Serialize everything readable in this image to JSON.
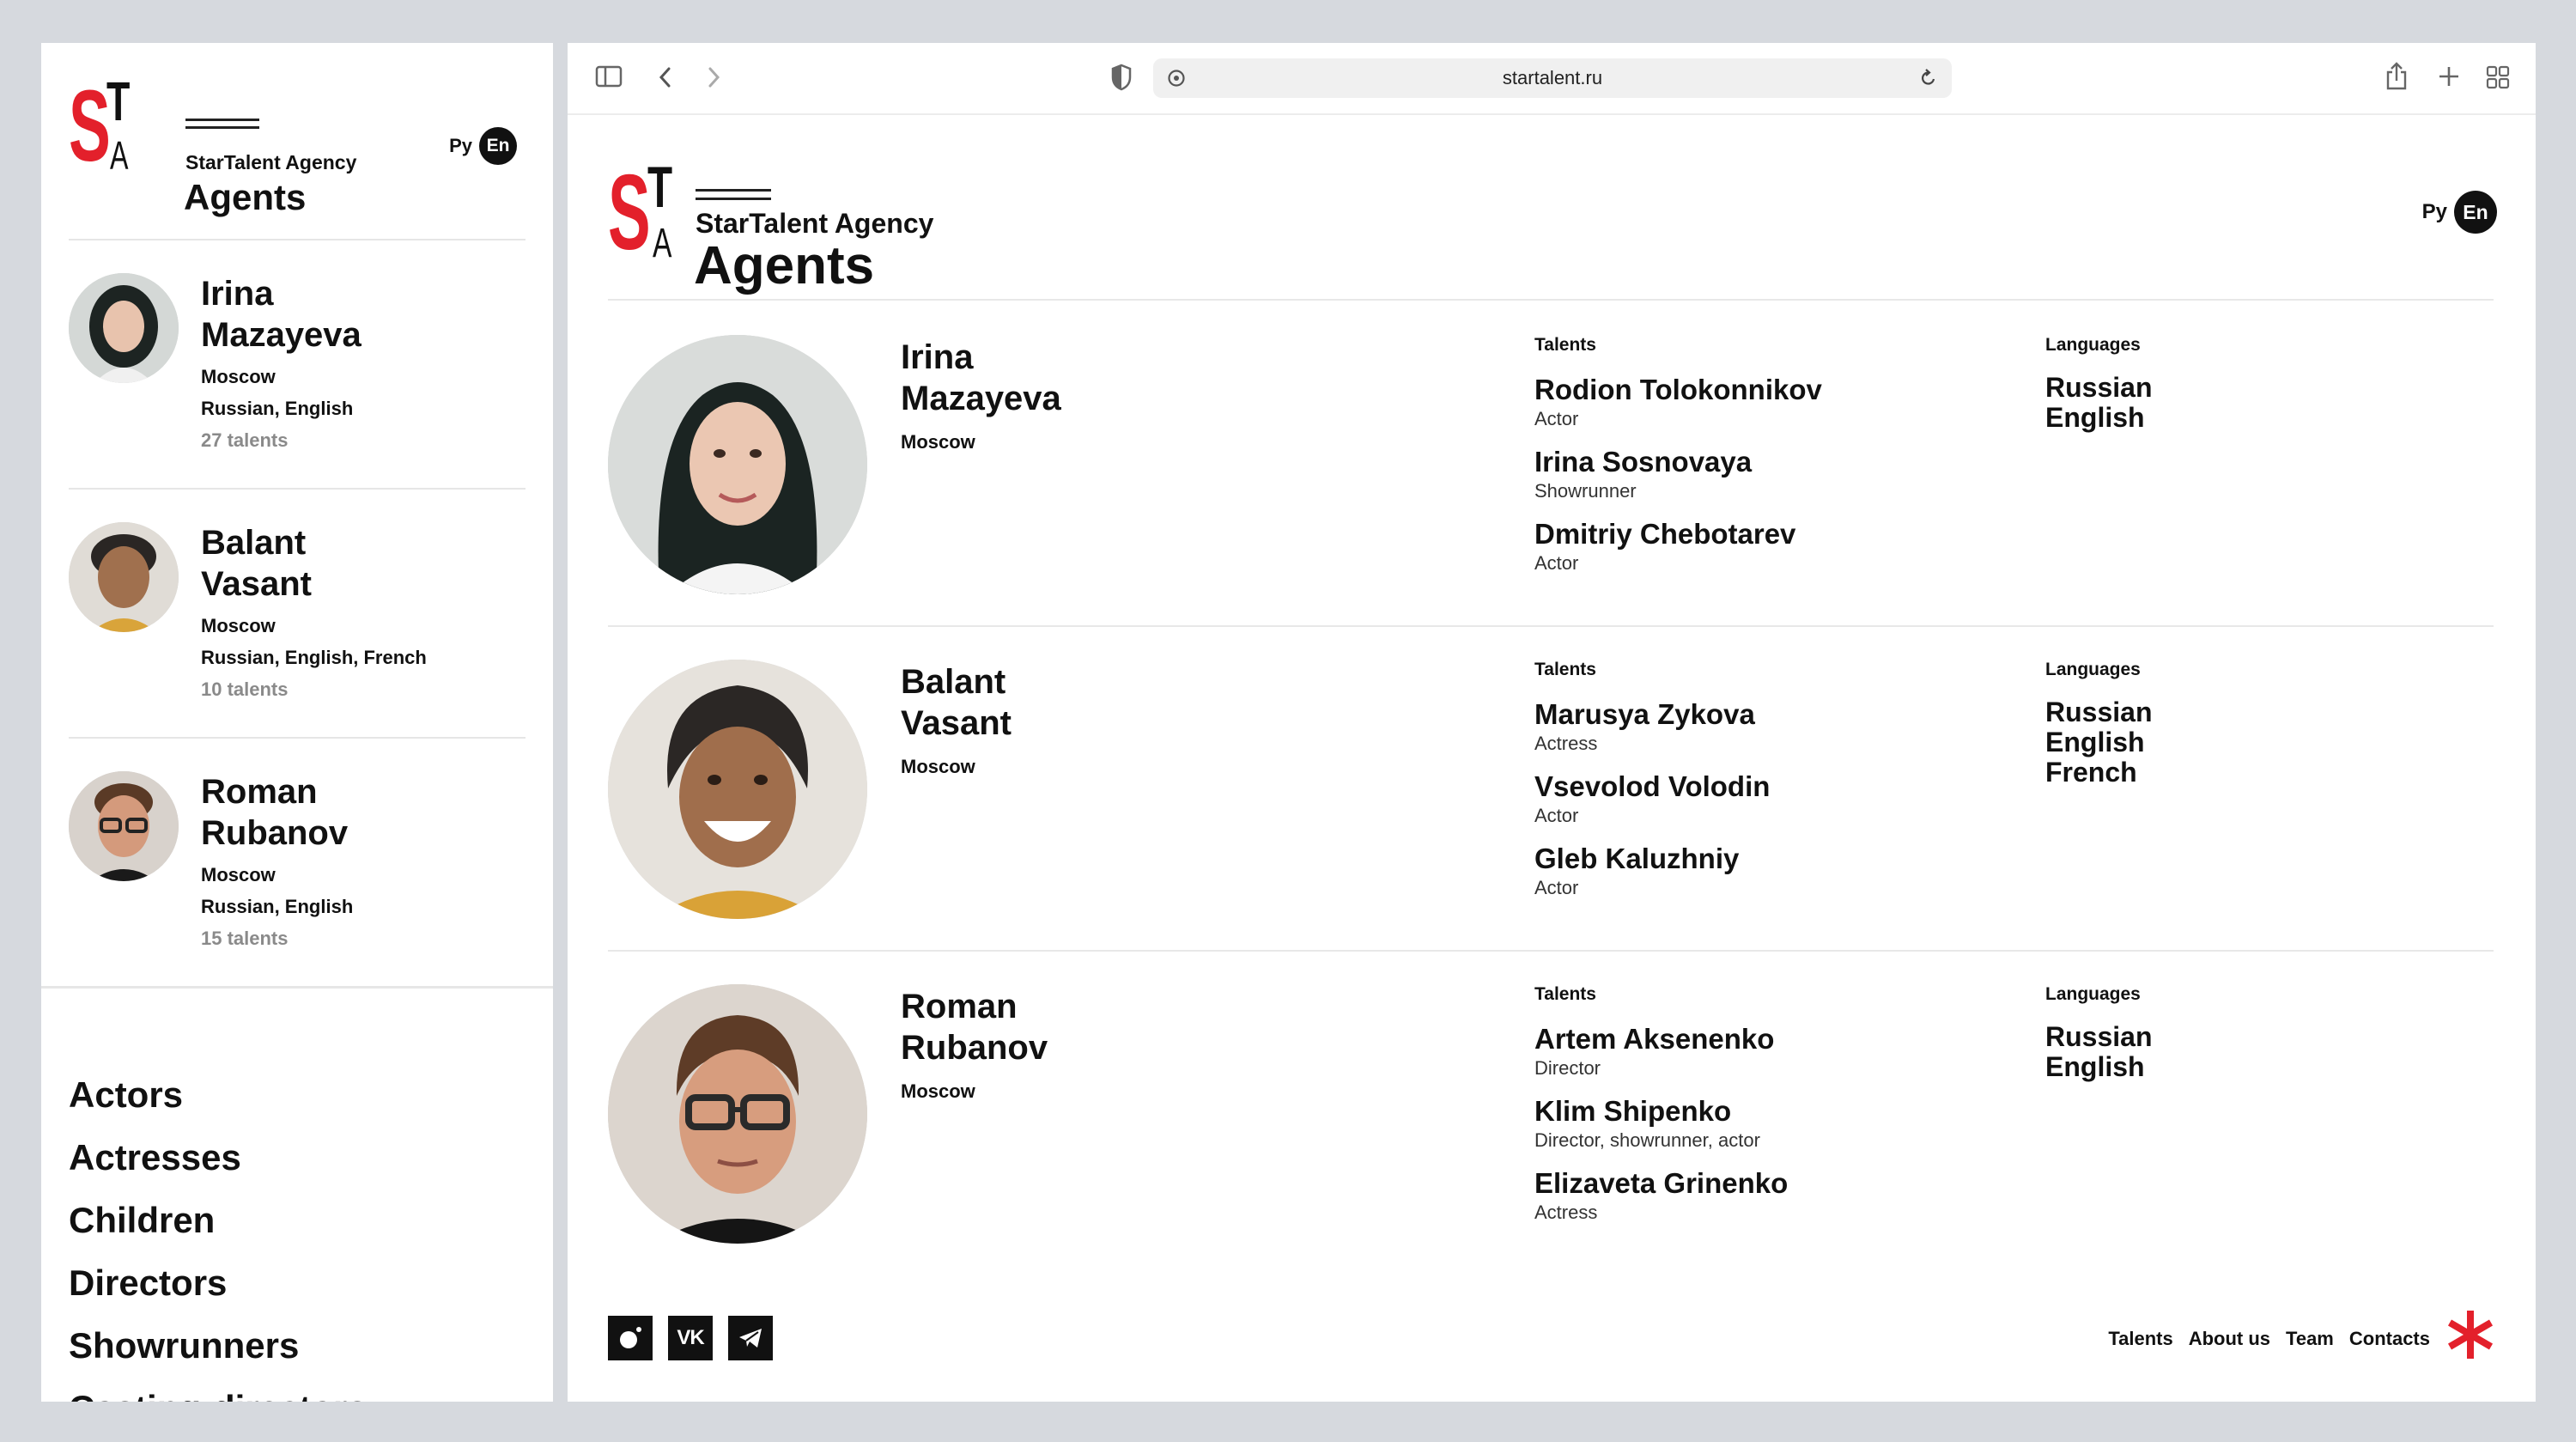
{
  "brand": {
    "logo_letters": [
      "S",
      "T",
      "A"
    ],
    "agency": "StarTalent Agency",
    "page_title": "Agents",
    "accent_color": "#e3202b"
  },
  "lang_switch": {
    "ru": "Ру",
    "en": "En"
  },
  "browser": {
    "url": "startalent.ru",
    "icons": [
      "sidebar-icon",
      "back-icon",
      "forward-icon",
      "shield-icon",
      "site-settings-icon",
      "reload-icon",
      "share-icon",
      "new-tab-icon",
      "tab-overview-icon"
    ]
  },
  "columns": {
    "talents": "Talents",
    "languages": "Languages"
  },
  "agents": [
    {
      "first": "Irina",
      "last": "Mazayeva",
      "city": "Moscow",
      "languages_line": "Russian, English",
      "talents_count": "27 talents",
      "languages": [
        "Russian",
        "English"
      ],
      "talents": [
        {
          "name": "Rodion Tolokonnikov",
          "role": "Actor"
        },
        {
          "name": "Irina Sosnovaya",
          "role": "Showrunner"
        },
        {
          "name": "Dmitriy Chebotarev",
          "role": "Actor"
        }
      ]
    },
    {
      "first": "Balant",
      "last": "Vasant",
      "city": "Moscow",
      "languages_line": "Russian, English, French",
      "talents_count": "10 talents",
      "languages": [
        "Russian",
        "English",
        "French"
      ],
      "talents": [
        {
          "name": "Marusya Zykova",
          "role": "Actress"
        },
        {
          "name": "Vsevolod Volodin",
          "role": "Actor"
        },
        {
          "name": "Gleb Kaluzhniy",
          "role": "Actor"
        }
      ]
    },
    {
      "first": "Roman",
      "last": "Rubanov",
      "city": "Moscow",
      "languages_line": "Russian, English",
      "talents_count": "15 talents",
      "languages": [
        "Russian",
        "English"
      ],
      "talents": [
        {
          "name": "Artem Aksenenko",
          "role": "Director"
        },
        {
          "name": "Klim Shipenko",
          "role": "Director, showrunner, actor"
        },
        {
          "name": "Elizaveta Grinenko",
          "role": "Actress"
        }
      ]
    }
  ],
  "menu": [
    "Actors",
    "Actresses",
    "Children",
    "Directors",
    "Showrunners",
    "Casting-directors"
  ],
  "footer": {
    "links": [
      "Talents",
      "About us",
      "Team",
      "Contacts"
    ],
    "social": [
      "instagram-icon",
      "vk-icon",
      "telegram-icon"
    ],
    "vk_label": "VK"
  }
}
